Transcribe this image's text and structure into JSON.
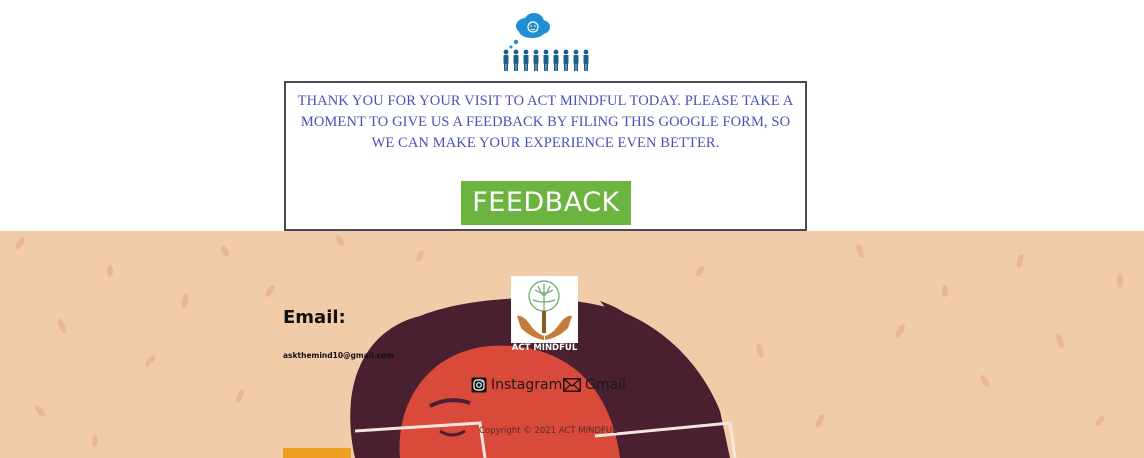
{
  "feedback": {
    "message": "THANK YOU FOR YOUR VISIT TO ACT MINDFUL TODAY. PLEASE TAKE A MOMENT TO GIVE US A FEEDBACK BY FILING THIS GOOGLE FORM, SO WE CAN MAKE YOUR EXPERIENCE EVEN BETTER.",
    "button_label": "FEEDBACK"
  },
  "footer": {
    "email_heading": "Email:",
    "email_value": "askthemind10@gmail.com",
    "brand_name": "ACT MINDFUL",
    "social": [
      {
        "label": "Instagram",
        "icon": "instagram-icon"
      },
      {
        "label": "Gmail",
        "icon": "mail-icon"
      }
    ],
    "copyright": "Copyright © 2021 ACT MINDFUL"
  },
  "colors": {
    "feedback_text": "#4c4fb8",
    "button": "#6db33f",
    "footer_bg": "#f2cba9",
    "border": "#4a4a55"
  }
}
